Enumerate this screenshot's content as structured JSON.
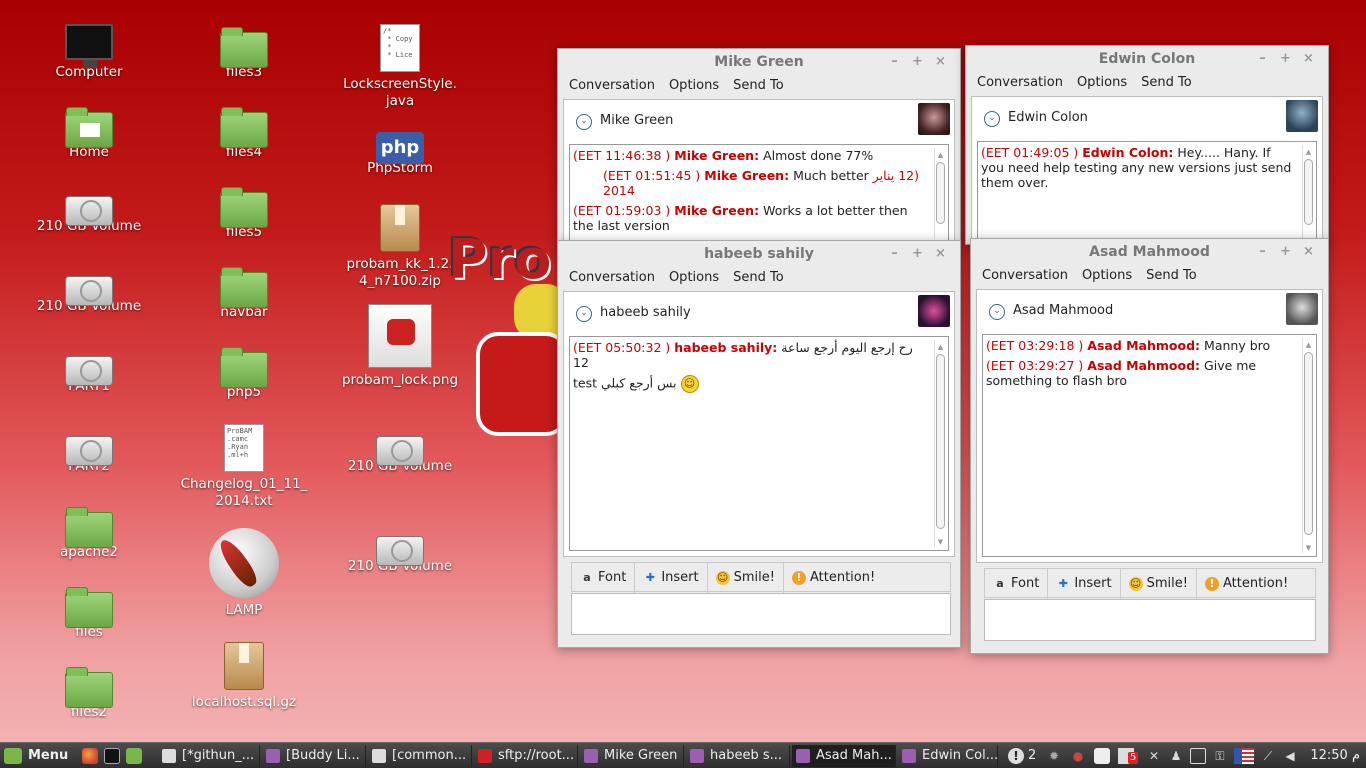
{
  "desktop": {
    "icons": [
      {
        "label": "Computer",
        "icon": "computer-icon"
      },
      {
        "label": "Home",
        "icon": "home-folder-icon"
      },
      {
        "label": "210 GB Volume",
        "icon": "drive-icon"
      },
      {
        "label": "210 GB Volume",
        "icon": "drive-icon"
      },
      {
        "label": "PART1",
        "icon": "drive-icon"
      },
      {
        "label": "PART2",
        "icon": "drive-icon"
      },
      {
        "label": "apache2",
        "icon": "folder-icon"
      },
      {
        "label": "files",
        "icon": "folder-icon"
      },
      {
        "label": "files2",
        "icon": "folder-icon"
      },
      {
        "label": "files3",
        "icon": "folder-icon"
      },
      {
        "label": "files4",
        "icon": "folder-icon"
      },
      {
        "label": "files5",
        "icon": "folder-icon"
      },
      {
        "label": "navbar",
        "icon": "folder-icon"
      },
      {
        "label": "php5",
        "icon": "folder-icon"
      },
      {
        "label": "Changelog_01_11_2014.txt",
        "icon": "text-file-icon"
      },
      {
        "label": "LAMP",
        "icon": "lamp-icon"
      },
      {
        "label": "localhost.sql.gz",
        "icon": "archive-icon"
      },
      {
        "label": "LockscreenStyle.java",
        "icon": "java-file-icon"
      },
      {
        "label": "PhpStorm",
        "icon": "phpstorm-icon"
      },
      {
        "label": "probam_kk_1.2.4_n7100.zip",
        "icon": "archive-icon"
      },
      {
        "label": "probam_lock.png",
        "icon": "image-file-icon"
      },
      {
        "label": "210 GB Volume",
        "icon": "drive-icon"
      },
      {
        "label": "210 GB Volume",
        "icon": "drive-icon"
      }
    ],
    "text_preview": {
      "changelog": "ProBAM\n.camc\n.Ryan\n.ml+h",
      "java": "/*\n * Copy\n *\n * Lice"
    },
    "php_badge": "php",
    "background_word": "Pro"
  },
  "chat_menu": {
    "conversation": "Conversation",
    "options": "Options",
    "send_to": "Send To"
  },
  "chat_toolbar": {
    "font": "Font",
    "insert": "Insert",
    "smile": "Smile!",
    "attention": "Attention!"
  },
  "windows": {
    "mike": {
      "title": "Mike Green",
      "contact": "Mike Green",
      "messages": [
        {
          "ts": "(EET 11:46:38 )",
          "who": "Mike Green:",
          "text": "Almost done 77%"
        },
        {
          "ts": "(EET 01:51:45 )",
          "who": "Mike Green:",
          "text": "Much better",
          "extra": "(12 يناير 2014"
        },
        {
          "ts": "(EET 01:59:03 )",
          "who": "Mike Green:",
          "text": "Works a lot better then the last version"
        }
      ]
    },
    "edwin": {
      "title": "Edwin Colon",
      "contact": "Edwin Colon",
      "messages": [
        {
          "ts": "(EET 01:49:05 )",
          "who": "Edwin Colon:",
          "text": "Hey.....  Hany.  If you need help testing any new versions just send them over."
        }
      ]
    },
    "habeeb": {
      "title": "habeeb sahily",
      "contact": "habeeb sahily",
      "messages": [
        {
          "ts": "(EET 05:50:32 )",
          "who": "habeeb sahily:",
          "text": "رح إرجع اليوم  أرجع ساعة 12"
        },
        {
          "ts": "",
          "who": "",
          "text": "بس أرجع كبلي test"
        }
      ]
    },
    "asad": {
      "title": "Asad Mahmood",
      "contact": "Asad Mahmood",
      "messages": [
        {
          "ts": "(EET 03:29:18 )",
          "who": "Asad Mahmood:",
          "text": "Manny bro"
        },
        {
          "ts": "(EET 03:29:27 )",
          "who": "Asad Mahmood:",
          "text": "Give me something to flash bro"
        }
      ]
    }
  },
  "window_buttons": {
    "min": "–",
    "max": "+",
    "close": "×"
  },
  "taskbar": {
    "menu_label": "Menu",
    "tasks": [
      {
        "label": "[*githun_...",
        "icon": "text-editor-icon"
      },
      {
        "label": "[Buddy Li...",
        "icon": "pidgin-icon"
      },
      {
        "label": "[common...",
        "icon": "text-editor-icon"
      },
      {
        "label": "sftp://root...",
        "icon": "filezilla-icon"
      },
      {
        "label": "Mike Green",
        "icon": "pidgin-icon"
      },
      {
        "label": "habeeb s...",
        "icon": "pidgin-icon"
      },
      {
        "label": "Asad Mah...",
        "icon": "pidgin-icon"
      },
      {
        "label": "Edwin Col...",
        "icon": "pidgin-icon"
      }
    ],
    "notification_count": "2",
    "mail_badge": "5",
    "clock": "12:50",
    "clock_suffix": "م"
  },
  "colors": {
    "accent_red": "#cc0000",
    "desktop_top": "#a80000",
    "desktop_bottom": "#f4b6b7",
    "mint_green": "#7ab648"
  }
}
